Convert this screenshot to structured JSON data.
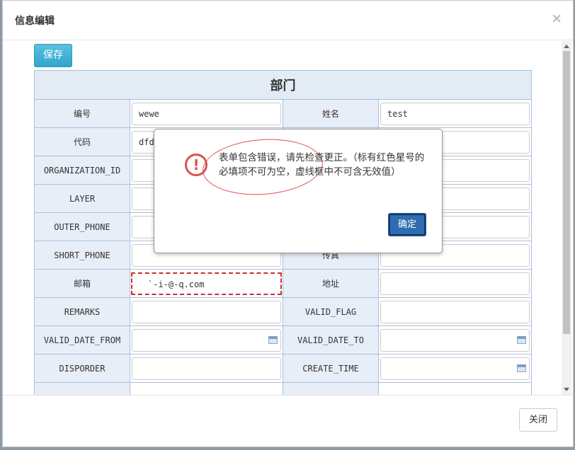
{
  "dialog": {
    "title": "信息编辑",
    "close_glyph": "×",
    "save_label": "保存",
    "close_label": "关闭"
  },
  "form": {
    "section_title": "部门",
    "rows": [
      {
        "left_label": "编号",
        "left_value": "wewe",
        "right_label": "姓名",
        "right_value": "test"
      },
      {
        "left_label": "代码",
        "left_value": "dfd",
        "right_label": "",
        "right_value": ""
      },
      {
        "left_label": "ORGANIZATION_ID",
        "left_value": "",
        "right_label": "",
        "right_value": ""
      },
      {
        "left_label": "LAYER",
        "left_value": "",
        "right_label": "",
        "right_value": ""
      },
      {
        "left_label": "OUTER_PHONE",
        "left_value": "",
        "right_label": "",
        "right_value": ""
      },
      {
        "left_label": "SHORT_PHONE",
        "left_value": "",
        "right_label": "传真",
        "right_value": ""
      },
      {
        "left_label": "邮箱",
        "left_value": "`-i-@-q.com",
        "right_label": "地址",
        "right_value": ""
      },
      {
        "left_label": "REMARKS",
        "left_value": "",
        "right_label": "VALID_FLAG",
        "right_value": ""
      },
      {
        "left_label": "VALID_DATE_FROM",
        "left_value": "",
        "right_label": "VALID_DATE_TO",
        "right_value": ""
      },
      {
        "left_label": "DISPORDER",
        "left_value": "",
        "right_label": "CREATE_TIME",
        "right_value": ""
      }
    ]
  },
  "alert": {
    "icon": "exclamation-circle-icon",
    "message": "表单包含错误，请先检查更正。（标有红色星号的必填项不可为空，虚线框中不可含无效值）",
    "ok_label": "确定"
  },
  "colors": {
    "label_bg": "#e8eef7",
    "border": "#a6c0dc",
    "save_btn": "#5bc0de",
    "ok_btn": "#2f6db3",
    "error": "#c9302c"
  }
}
